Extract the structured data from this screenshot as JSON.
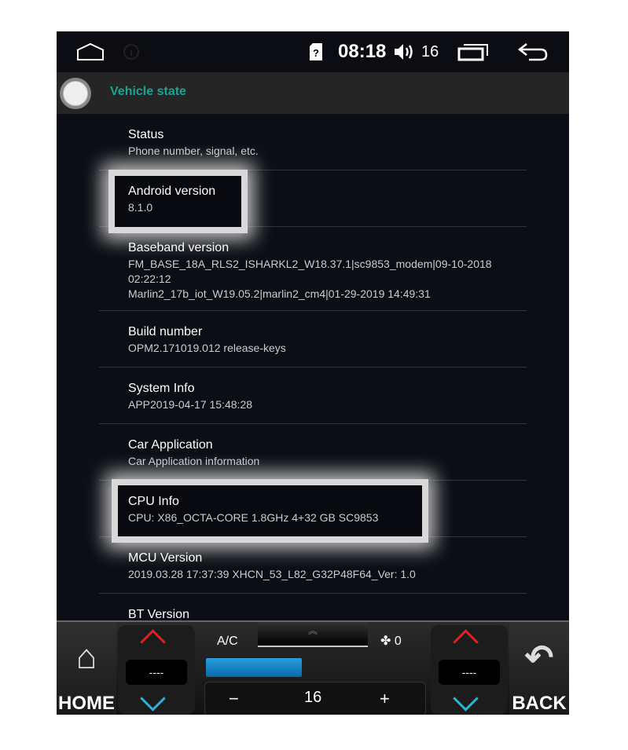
{
  "statusbar": {
    "home_icon": "home-outline-icon",
    "info_icon": "info-icon",
    "sim_icon": "sim-unknown-icon",
    "time": "08:18",
    "volume_icon": "volume-icon",
    "volume": "16",
    "recents_icon": "recents-icon",
    "back_icon": "back-arrow-icon"
  },
  "titlebar": {
    "title": "Vehicle state"
  },
  "colors": {
    "title_accent": "#19a394",
    "ac_bar": "#1a86c8",
    "up_arrow": "#e02020",
    "down_arrow": "#2ab4d8"
  },
  "items": [
    {
      "title": "Status",
      "sub": "Phone number, signal, etc."
    },
    {
      "title": "Android version",
      "sub": "8.1.0",
      "highlighted": true
    },
    {
      "title": "Baseband version",
      "sub": "FM_BASE_18A_RLS2_ISHARKL2_W18.37.1|sc9853_modem|09-10-2018 02:22:12",
      "sub2": "Marlin2_17b_iot_W19.05.2|marlin2_cm4|01-29-2019 14:49:31"
    },
    {
      "title": "Build number",
      "sub": "OPM2.171019.012 release-keys"
    },
    {
      "title": "System Info",
      "sub": "APP2019-04-17 15:48:28"
    },
    {
      "title": "Car Application",
      "sub": "Car Application information"
    },
    {
      "title": "CPU Info",
      "sub": "CPU: X86_OCTA-CORE 1.8GHz 4+32 GB SC9853",
      "highlighted": true
    },
    {
      "title": "MCU Version",
      "sub": "2019.03.28 17:37:39 XHCN_53_L82_G32P48F64_Ver: 1.0"
    },
    {
      "title": "BT Version",
      "sub": ""
    }
  ],
  "panel": {
    "home_label": "HOME",
    "back_label": "BACK",
    "left_temp": "----",
    "right_temp": "----",
    "ac_label": "A/C",
    "fan_speed": "0",
    "fan_level_percent": 44,
    "temperature": "16",
    "minus": "−",
    "plus": "+"
  }
}
